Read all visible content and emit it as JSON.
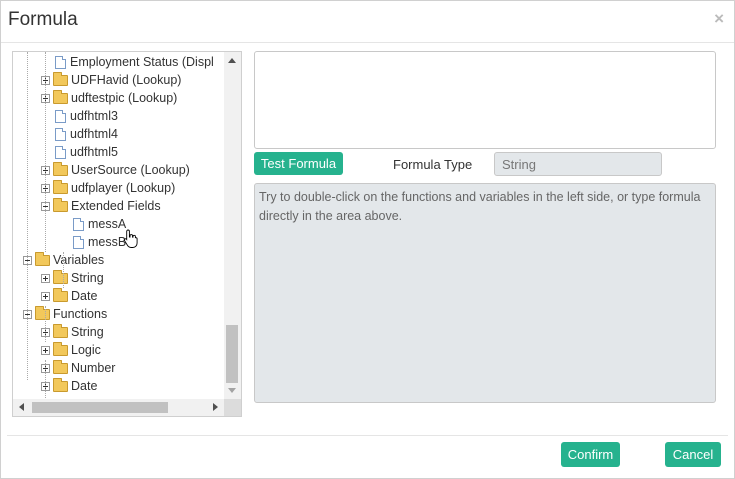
{
  "dialog": {
    "title": "Formula",
    "close_label": "×"
  },
  "tree": {
    "nodes": [
      {
        "label": "Employment Status (Displ",
        "kind": "file",
        "expander": "none",
        "level": 2
      },
      {
        "label": "UDFHavid (Lookup)",
        "kind": "folder",
        "expander": "plus",
        "level": 2
      },
      {
        "label": "udftestpic (Lookup)",
        "kind": "folder",
        "expander": "plus",
        "level": 2
      },
      {
        "label": "udfhtml3",
        "kind": "file",
        "expander": "none",
        "level": 2
      },
      {
        "label": "udfhtml4",
        "kind": "file",
        "expander": "none",
        "level": 2
      },
      {
        "label": "udfhtml5",
        "kind": "file",
        "expander": "none",
        "level": 2
      },
      {
        "label": "UserSource (Lookup)",
        "kind": "folder",
        "expander": "plus",
        "level": 2
      },
      {
        "label": "udfplayer (Lookup)",
        "kind": "folder",
        "expander": "plus",
        "level": 2
      },
      {
        "label": "Extended Fields",
        "kind": "folder",
        "expander": "minus",
        "level": 2
      },
      {
        "label": "messA",
        "kind": "file",
        "expander": "none",
        "level": 3
      },
      {
        "label": "messB",
        "kind": "file",
        "expander": "none",
        "level": 3
      },
      {
        "label": "Variables",
        "kind": "folder",
        "expander": "minus",
        "level": 1
      },
      {
        "label": "String",
        "kind": "folder",
        "expander": "plus",
        "level": 2
      },
      {
        "label": "Date",
        "kind": "folder",
        "expander": "plus",
        "level": 2
      },
      {
        "label": "Functions",
        "kind": "folder",
        "expander": "minus",
        "level": 1
      },
      {
        "label": "String",
        "kind": "folder",
        "expander": "plus",
        "level": 2
      },
      {
        "label": "Logic",
        "kind": "folder",
        "expander": "plus",
        "level": 2
      },
      {
        "label": "Number",
        "kind": "folder",
        "expander": "plus",
        "level": 2
      },
      {
        "label": "Date",
        "kind": "folder",
        "expander": "plus",
        "level": 2
      }
    ]
  },
  "editor": {
    "value": ""
  },
  "toolbar": {
    "test_label": "Test Formula",
    "formula_type_label": "Formula Type",
    "formula_type_value": "String"
  },
  "hint": {
    "text": "Try to double-click on the functions and variables in the left side, or type formula directly in the area above."
  },
  "footer": {
    "confirm_label": "Confirm",
    "cancel_label": "Cancel"
  },
  "colors": {
    "accent": "#26b28e",
    "readonly_bg": "#e3e7ea"
  }
}
